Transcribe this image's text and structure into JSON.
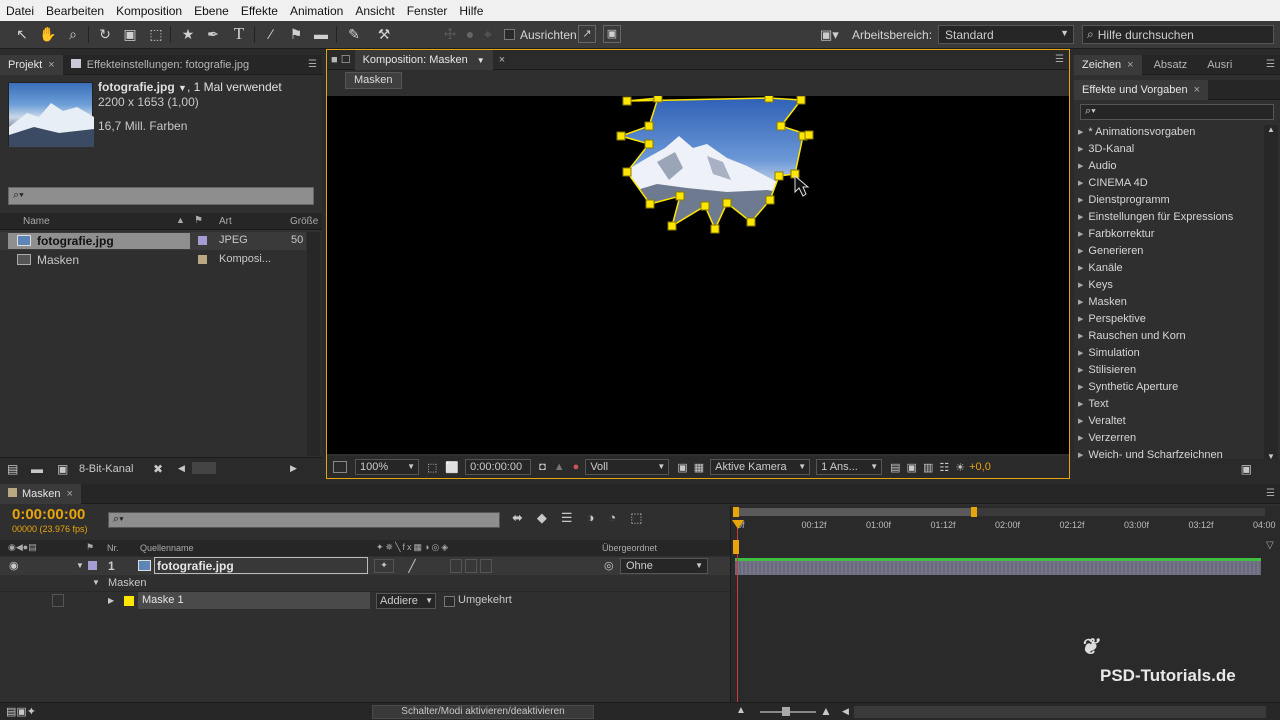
{
  "menu": [
    "Datei",
    "Bearbeiten",
    "Komposition",
    "Ebene",
    "Effekte",
    "Animation",
    "Ansicht",
    "Fenster",
    "Hilfe"
  ],
  "toolbar": {
    "align_label": "Ausrichten",
    "workspace_label": "Arbeitsbereich:",
    "workspace_value": "Standard",
    "help_placeholder": "Hilfe durchsuchen"
  },
  "project": {
    "tab": "Projekt",
    "effects_tab": "Effekteinstellungen: fotografie.jpg",
    "file_name": "fotografie.jpg",
    "usage": ", 1 Mal verwendet",
    "dimensions": "2200 x 1653 (1,00)",
    "colors": "16,7 Mill. Farben",
    "search_icon": "⌕▾",
    "columns": {
      "name": "Name",
      "type": "Art",
      "size": "Größe"
    },
    "items": [
      {
        "name": "fotografie.jpg",
        "type": "JPEG",
        "size": "50",
        "label_color": "#a59cd4"
      },
      {
        "name": "Masken",
        "type": "Komposi...",
        "size": "",
        "label_color": "#b9a882"
      }
    ],
    "bitdepth": "8-Bit-Kanal"
  },
  "composition": {
    "tab": "Komposition: Masken",
    "chip": "Masken",
    "zoom": "100%",
    "timecode": "0:00:00:00",
    "resolution": "Voll",
    "camera": "Aktive Kamera",
    "views": "1 Ans...",
    "exposure": "+0,0"
  },
  "right": {
    "tabs": [
      "Zeichen",
      "Absatz",
      "Ausri"
    ],
    "effects_title": "Effekte und Vorgaben",
    "search_icon": "⌕▾",
    "items": [
      "* Animationsvorgaben",
      "3D-Kanal",
      "Audio",
      "CINEMA 4D",
      "Dienstprogramm",
      "Einstellungen für Expressions",
      "Farbkorrektur",
      "Generieren",
      "Kanäle",
      "Keys",
      "Masken",
      "Perspektive",
      "Rauschen und Korn",
      "Simulation",
      "Stilisieren",
      "Synthetic Aperture",
      "Text",
      "Veraltet",
      "Verzerren",
      "Weich- und Scharfzeichnen"
    ]
  },
  "timeline": {
    "tab": "Masken",
    "timecode": "0:00:00:00",
    "fps": "00000 (23.976 fps)",
    "col_nr": "Nr.",
    "col_source": "Quellenname",
    "col_parent": "Übergeordnet",
    "layer_nr": "1",
    "layer_name": "fotografie.jpg",
    "parent_value": "Ohne",
    "masks_group": "Masken",
    "mask_name": "Maske 1",
    "mask_mode": "Addiere",
    "inverted_label": "Umgekehrt",
    "ticks": [
      "0f",
      "00:12f",
      "01:00f",
      "01:12f",
      "02:00f",
      "02:12f",
      "03:00f",
      "03:12f",
      "04:00"
    ],
    "switches_label": "Schalter/Modi aktivieren/deaktivieren",
    "colors": {
      "accent": "#e8a40c",
      "bar": "#3fbf3f",
      "playhead": "#c83c3c"
    }
  },
  "watermark": "PSD-Tutorials.de"
}
